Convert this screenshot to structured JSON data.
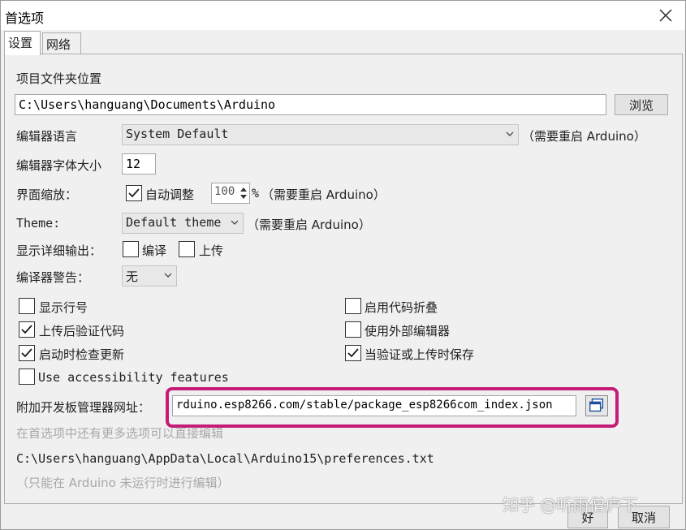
{
  "window": {
    "title": "首选项"
  },
  "tabs": [
    {
      "label": "设置"
    },
    {
      "label": "网络"
    }
  ],
  "sketchbook": {
    "label": "项目文件夹位置",
    "path": "C:\\Users\\hanguang\\Documents\\Arduino",
    "browse_label": "浏览"
  },
  "editor_language": {
    "label": "编辑器语言",
    "value": "System Default",
    "note": "（需要重启 Arduino）"
  },
  "editor_font_size": {
    "label": "编辑器字体大小",
    "value": "12"
  },
  "interface_scale": {
    "label": "界面缩放：",
    "auto_label": "自动调整",
    "auto_checked": true,
    "value": "100",
    "unit": "%",
    "note": "（需要重启 Arduino）"
  },
  "theme": {
    "label": "Theme:",
    "value": "Default theme",
    "note": "（需要重启 Arduino）"
  },
  "verbose_output": {
    "label": "显示详细输出：",
    "compile_label": "编译",
    "compile_checked": false,
    "upload_label": "上传",
    "upload_checked": false
  },
  "compiler_warnings": {
    "label": "编译器警告：",
    "value": "无"
  },
  "options_left": [
    {
      "label": "显示行号",
      "checked": false
    },
    {
      "label": "上传后验证代码",
      "checked": true
    },
    {
      "label": "启动时检查更新",
      "checked": true
    },
    {
      "label": "Use accessibility features",
      "checked": false
    }
  ],
  "options_right": [
    {
      "label": "启用代码折叠",
      "checked": false
    },
    {
      "label": "使用外部编辑器",
      "checked": false
    },
    {
      "label": "当验证或上传时保存",
      "checked": true
    }
  ],
  "board_urls": {
    "label": "附加开发板管理器网址：",
    "value": "rduino.esp8266.com/stable/package_esp8266com_index.json"
  },
  "more_prefs_note": "在首选项中还有更多选项可以直接编辑",
  "prefs_path": "C:\\Users\\hanguang\\AppData\\Local\\Arduino15\\preferences.txt",
  "edit_note": "（只能在 Arduino 未运行时进行编辑）",
  "buttons": {
    "ok": "好",
    "cancel": "取消"
  },
  "watermark": "知乎 @听雨僧庐下",
  "colors": {
    "highlight": "#c51c78",
    "checkmark": "#1a1a1a"
  }
}
